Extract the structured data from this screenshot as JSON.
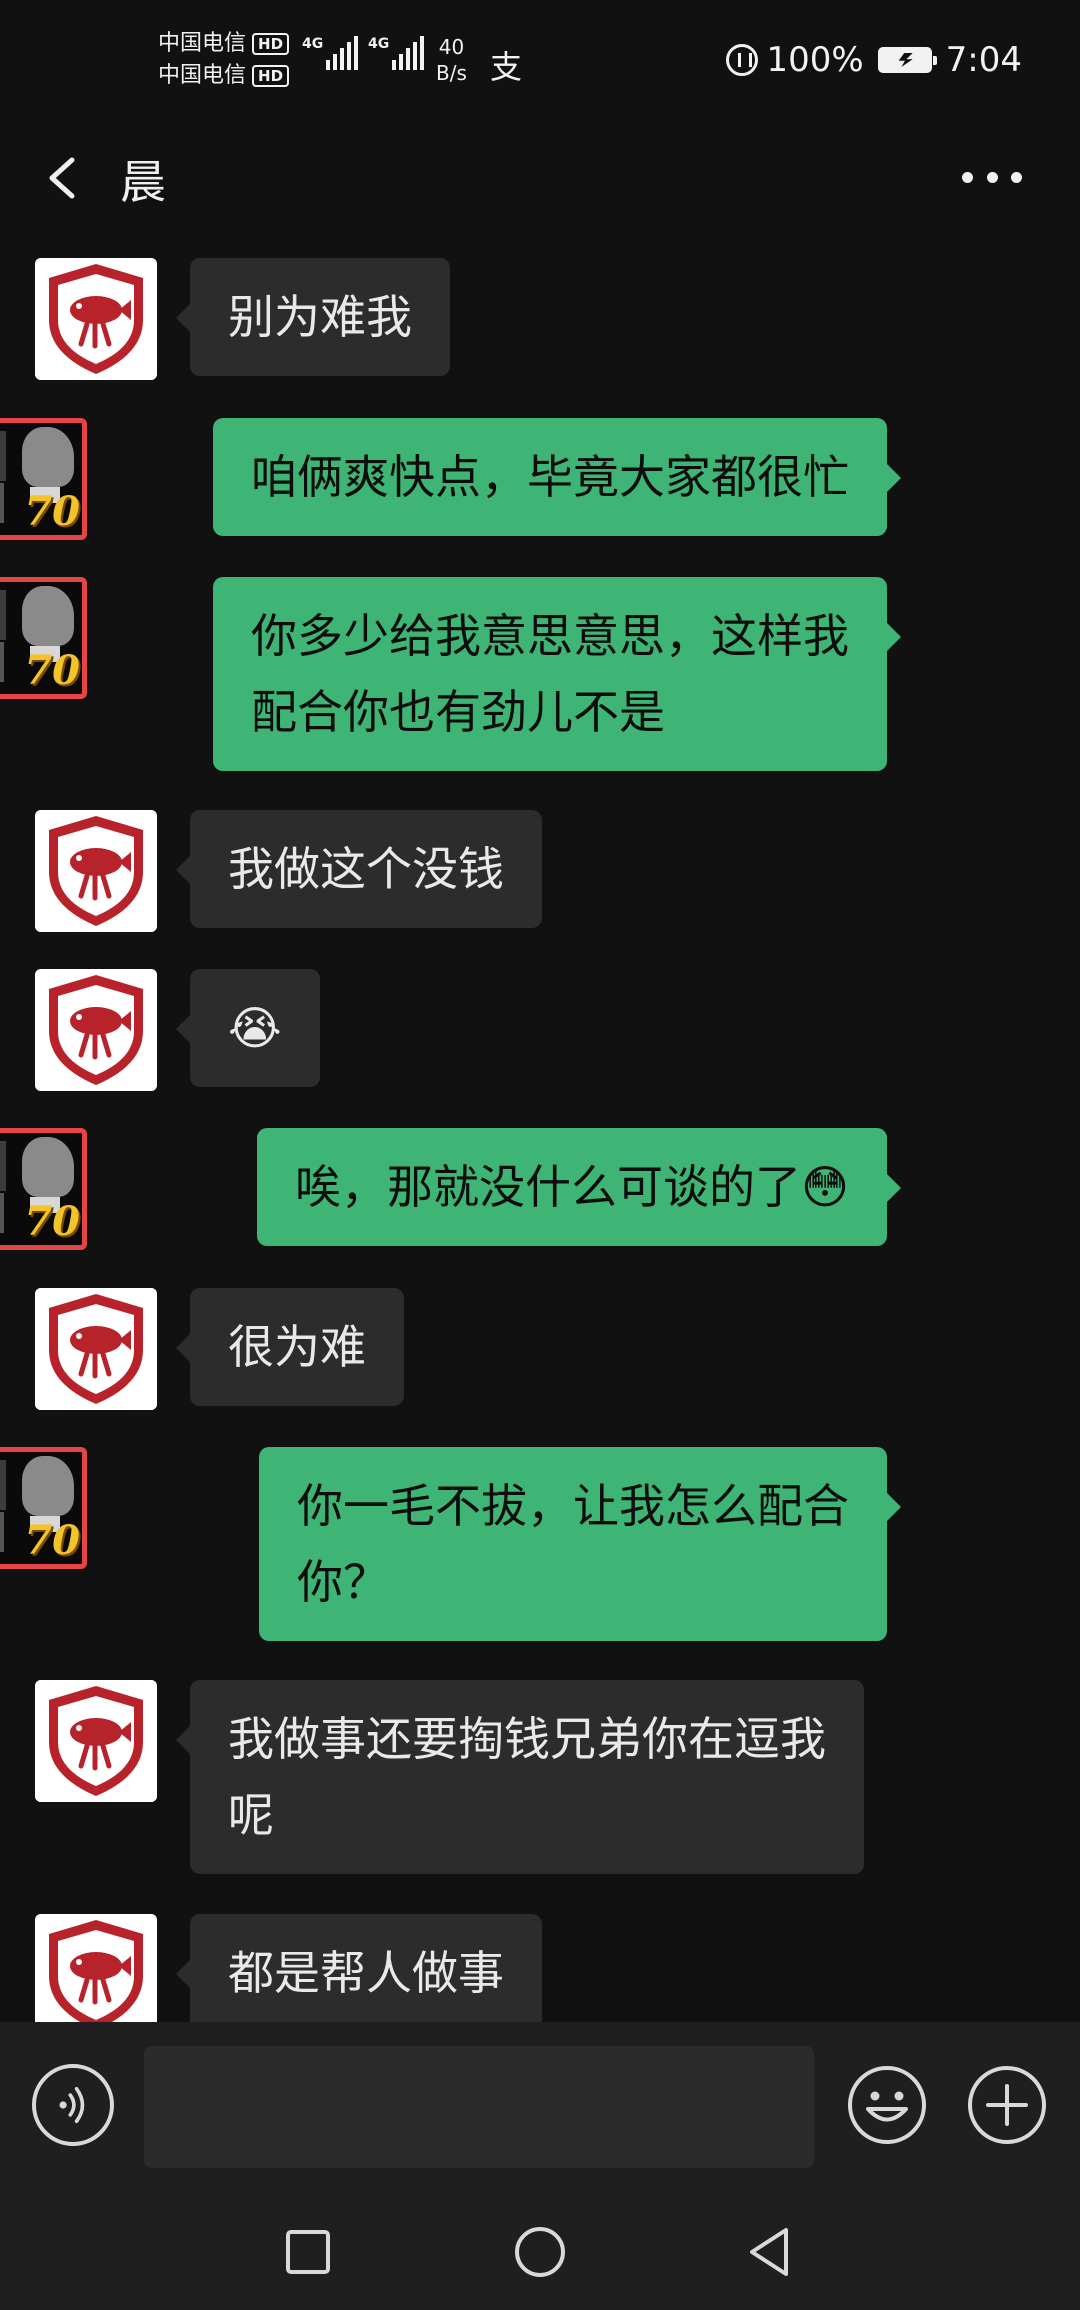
{
  "status_bar": {
    "carrier1": "中国电信",
    "carrier2": "中国电信",
    "hd_label": "HD",
    "network_type": "4G",
    "speed_value": "40",
    "speed_unit": "B/s",
    "battery_percent": "100%",
    "time": "7:04"
  },
  "header": {
    "title": "晨",
    "back_icon": "chevron-left-icon",
    "more_icon": "more-dots-icon"
  },
  "messages": [
    {
      "side": "left",
      "lines": [
        "别为难我"
      ]
    },
    {
      "side": "right",
      "lines": [
        "咱俩爽快点，毕竟大家都很忙"
      ]
    },
    {
      "side": "right",
      "lines": [
        "你多少给我意思意思，这样我",
        "配合你也有劲儿不是"
      ]
    },
    {
      "side": "left",
      "lines": [
        "我做这个没钱"
      ]
    },
    {
      "side": "left",
      "lines": [
        "😭"
      ]
    },
    {
      "side": "right",
      "lines": [
        "唉，那就没什么可谈的了😳"
      ]
    },
    {
      "side": "left",
      "lines": [
        "很为难"
      ]
    },
    {
      "side": "right",
      "lines": [
        "你一毛不拔，让我怎么配合",
        "你？"
      ]
    },
    {
      "side": "left",
      "lines": [
        "我做事还要掏钱兄弟你在逗我",
        "呢"
      ]
    },
    {
      "side": "left",
      "lines": [
        "都是帮人做事"
      ]
    }
  ],
  "avatars": {
    "contact_badge": "70"
  },
  "input_bar": {
    "value": "",
    "placeholder": "",
    "voice_icon": "voice-icon",
    "emoji_icon": "emoji-icon",
    "plus_icon": "plus-icon"
  },
  "nav": {
    "recents_icon": "square-icon",
    "home_icon": "circle-icon",
    "back_icon": "triangle-back-icon"
  },
  "colors": {
    "background": "#111111",
    "bubble_in": "#2c2c2c",
    "bubble_out": "#3eb575",
    "avatar_red": "#b8232b"
  }
}
